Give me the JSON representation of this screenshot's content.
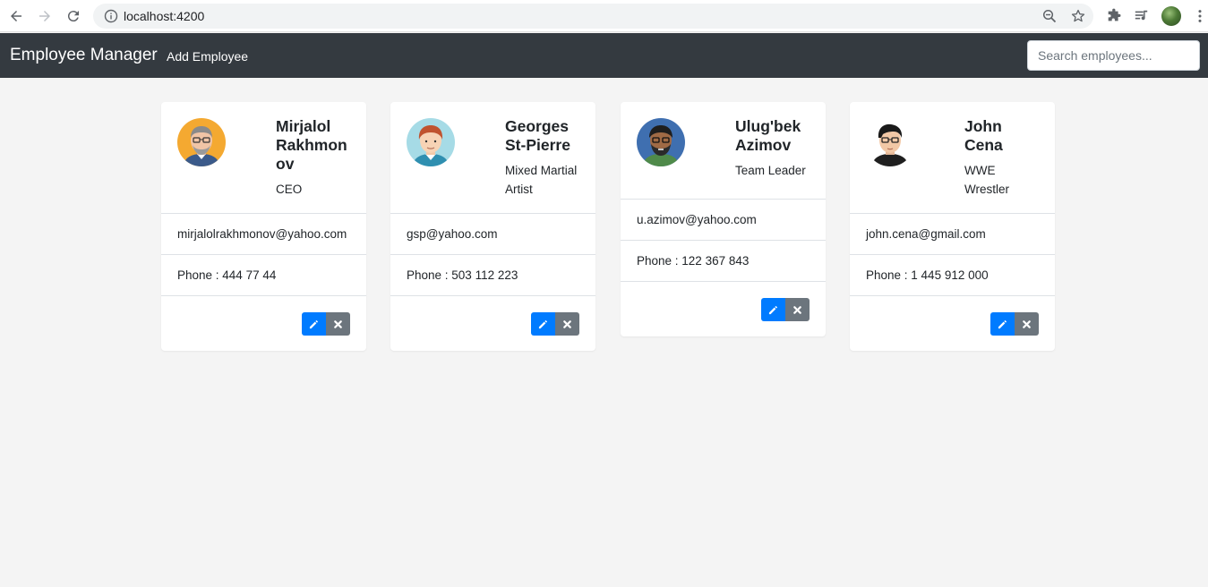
{
  "browser": {
    "url": "localhost:4200"
  },
  "navbar": {
    "brand": "Employee Manager",
    "add_link": "Add Employee",
    "search_placeholder": "Search employees..."
  },
  "colors": {
    "navbar_bg": "#343a40",
    "edit_button": "#007bff",
    "delete_button": "#6c757d",
    "page_bg": "#f4f4f4"
  },
  "employees": [
    {
      "name": "Mirjalol Rakhmonov",
      "job_title": "CEO",
      "email": "mirjalolrakhmonov@yahoo.com",
      "phone": "Phone : 444 77 44",
      "avatar_icon": "man-glasses-avatar-icon"
    },
    {
      "name": "Georges St-Pierre",
      "job_title": "Mixed Martial Artist",
      "email": "gsp@yahoo.com",
      "phone": "Phone : 503 112 223",
      "avatar_icon": "man-red-hair-avatar-icon"
    },
    {
      "name": "Ulug'bek Azimov",
      "job_title": "Team Leader",
      "email": "u.azimov@yahoo.com",
      "phone": "Phone : 122 367 843",
      "avatar_icon": "man-beard-avatar-icon"
    },
    {
      "name": "John Cena",
      "job_title": "WWE Wrestler",
      "email": "john.cena@gmail.com",
      "phone": "Phone : 1 445 912 000",
      "avatar_icon": "man-dark-hair-avatar-icon"
    }
  ]
}
